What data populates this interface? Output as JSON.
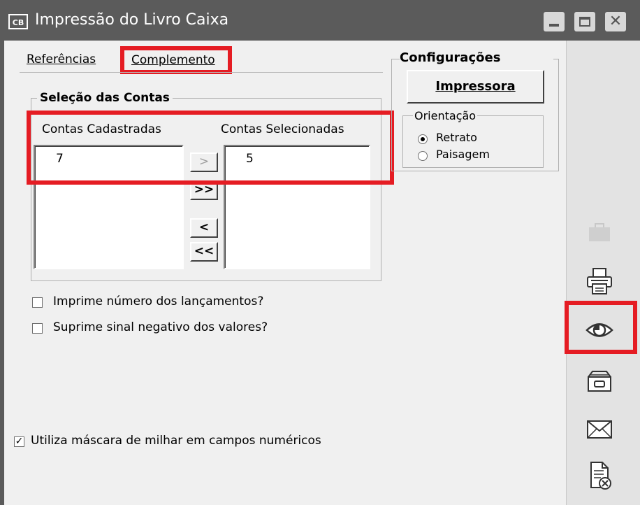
{
  "window": {
    "app_icon_text": "CB",
    "title": "Impressão do Livro Caixa"
  },
  "tabs": [
    {
      "label": "Referências",
      "selected": true
    },
    {
      "label": "Complemento",
      "selected": false
    }
  ],
  "contas": {
    "group_title": "Seleção das Contas",
    "left_label": "Contas Cadastradas",
    "right_label": "Contas Selecionadas",
    "left_items": [
      "7"
    ],
    "right_items": [
      "5"
    ],
    "buttons": [
      ">",
      ">>",
      "<",
      "<<"
    ]
  },
  "options": {
    "imprime_numero": {
      "label": "Imprime número dos lançamentos?",
      "checked": false
    },
    "suprime_sinal": {
      "label": "Suprime sinal negativo dos valores?",
      "checked": false
    },
    "mascara_milhar": {
      "label": "Utiliza máscara de milhar em campos numéricos",
      "checked": true
    }
  },
  "configuracoes": {
    "title": "Configurações",
    "printer_button": "Impressora",
    "orientation_title": "Orientação",
    "orientation_options": [
      "Retrato",
      "Paisagem"
    ],
    "orientation_selected": "Retrato"
  },
  "side_toolbar": [
    {
      "icon": "briefcase-icon",
      "enabled": false
    },
    {
      "icon": "printer-icon",
      "enabled": true
    },
    {
      "icon": "eye-icon",
      "enabled": true
    },
    {
      "icon": "disk-drawer-icon",
      "enabled": true
    },
    {
      "icon": "envelope-icon",
      "enabled": true
    },
    {
      "icon": "document-close-icon",
      "enabled": true
    }
  ],
  "highlight_color": "#e51c23"
}
